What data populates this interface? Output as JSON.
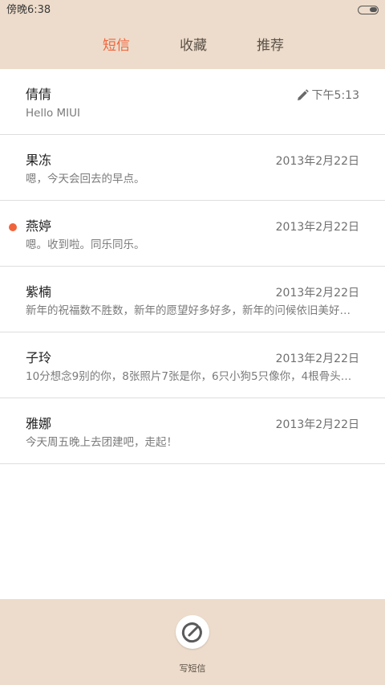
{
  "status_bar": {
    "time": "傍晚6:38",
    "battery_level": 0.45
  },
  "tabs": [
    {
      "label": "短信",
      "active": true
    },
    {
      "label": "收藏",
      "active": false
    },
    {
      "label": "推荐",
      "active": false
    }
  ],
  "conversations": [
    {
      "name": "倩倩",
      "snippet": "Hello MIUI",
      "date": "下午5:13",
      "draft": true,
      "unread": false
    },
    {
      "name": "果冻",
      "snippet": "嗯，今天会回去的早点。",
      "date": "2013年2月22日",
      "draft": false,
      "unread": false
    },
    {
      "name": "燕婷",
      "snippet": "嗯。收到啦。同乐同乐。",
      "date": "2013年2月22日",
      "draft": false,
      "unread": true
    },
    {
      "name": "紫楠",
      "snippet": "新年的祝福数不胜数，新年的愿望好多好多，新年的问候依旧美好…",
      "date": "2013年2月22日",
      "draft": false,
      "unread": false
    },
    {
      "name": "子玲",
      "snippet": "10分想念9别的你，8张照片7张是你，6只小狗5只像你，4根骨头…",
      "date": "2013年2月22日",
      "draft": false,
      "unread": false
    },
    {
      "name": "雅娜",
      "snippet": "今天周五晚上去团建吧，走起！",
      "date": "2013年2月22日",
      "draft": false,
      "unread": false
    }
  ],
  "bottom_bar": {
    "compose_label": "写短信"
  },
  "colors": {
    "header_bg": "#eddccb",
    "accent": "#f0643c"
  }
}
